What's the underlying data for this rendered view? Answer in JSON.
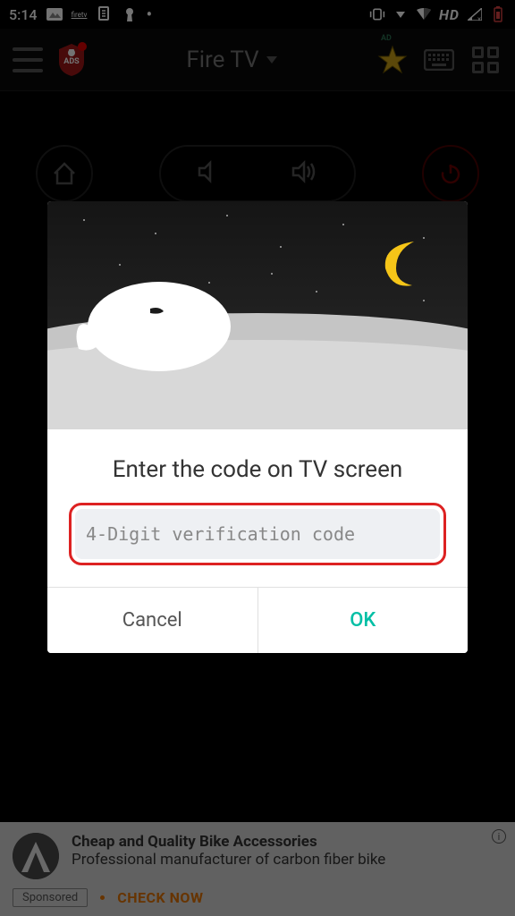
{
  "status_bar": {
    "time": "5:14",
    "hd_indicator": "HD"
  },
  "header": {
    "device_label": "Fire TV",
    "ad_tag": "AD"
  },
  "dialog": {
    "title": "Enter the code on TV screen",
    "placeholder": "4-Digit verification code",
    "value": "",
    "cancel_label": "Cancel",
    "ok_label": "OK"
  },
  "ad": {
    "title": "Cheap and Quality Bike Accessories",
    "description": "Professional manufacturer of carbon fiber bike",
    "sponsored_label": "Sponsored",
    "cta": "CHECK NOW",
    "info_glyph": "i"
  }
}
